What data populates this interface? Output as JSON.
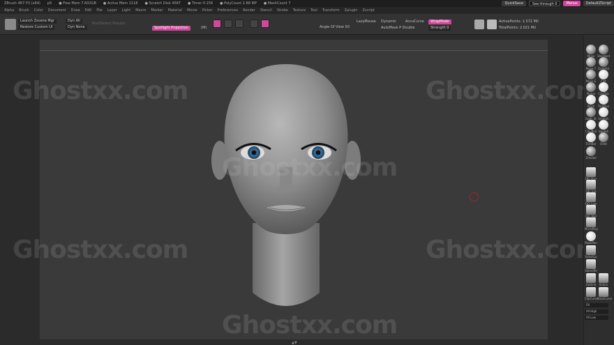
{
  "titlebar": {
    "app": "ZBrush 4R7 P3 (x64)",
    "doc": "p5",
    "free_mem": "● Free Mem 7.602GB",
    "active_mem": "● Active Mem 1118",
    "scratch": "● Scratch Disk 4587",
    "timer": "● Timer 0.156",
    "polycount": "● PolyCount 2.88 MP",
    "meshcount": "● MeshCount 7",
    "quicksave": "QuickSave",
    "seethrough": "See-through 0",
    "menus": "Menus",
    "script": "DefaultZScript"
  },
  "menubar": [
    "Alpha",
    "Brush",
    "Color",
    "Document",
    "Draw",
    "Edit",
    "File",
    "Layer",
    "Light",
    "Macro",
    "Marker",
    "Material",
    "Movie",
    "Picker",
    "Preferences",
    "Render",
    "Stencil",
    "Stroke",
    "Texture",
    "Tool",
    "Transform",
    "Zplugin",
    "Zscript"
  ],
  "toolbar": {
    "launch_zscene": "Launch Zscene Mgr",
    "restore_custom": "Restore Custom UI",
    "dyn_all": "Dyn All",
    "dyn_none": "Dyn None",
    "multiselect": "MultiSelect Presets",
    "spotlight": "Spotlight Projection",
    "spotlight_key": "(M)",
    "angle_of_view": "Angle Of View 50",
    "lazymouse": "LazyMouse",
    "dynamic": "Dynamic",
    "accucurve": "AccuCurve",
    "wrapmode": "WrapMode",
    "automask": "AutoMask P Double",
    "strength": "Strength 0",
    "active_points": "ActivePoints: 1.572 Mil",
    "total_points": "TotalPoints: 2.021 Mil"
  },
  "watermark": "Ghostxx.com",
  "right_shelf": {
    "brushes": [
      "Move",
      "Standard",
      "Move T",
      "DamStd",
      "Move E",
      "Flat",
      "Planar",
      "ClayTub",
      "Pinch",
      "TrimDyn",
      "Dam_St",
      "Smooth",
      "ClayBuil",
      "Hpolish",
      "TrimBor",
      "Orbit",
      "Zmodel",
      "ZRemesh",
      "DO_Dyn",
      "DO_Init",
      "DO_Low",
      "DO_Mid",
      "MicroPoly",
      "MaskPen",
      "SelectLa",
      "SelectRe",
      "Outline",
      "Action",
      "ClipCurve",
      "SliceCurve"
    ],
    "buttons": [
      "Fill",
      "All High",
      "All Low"
    ]
  }
}
